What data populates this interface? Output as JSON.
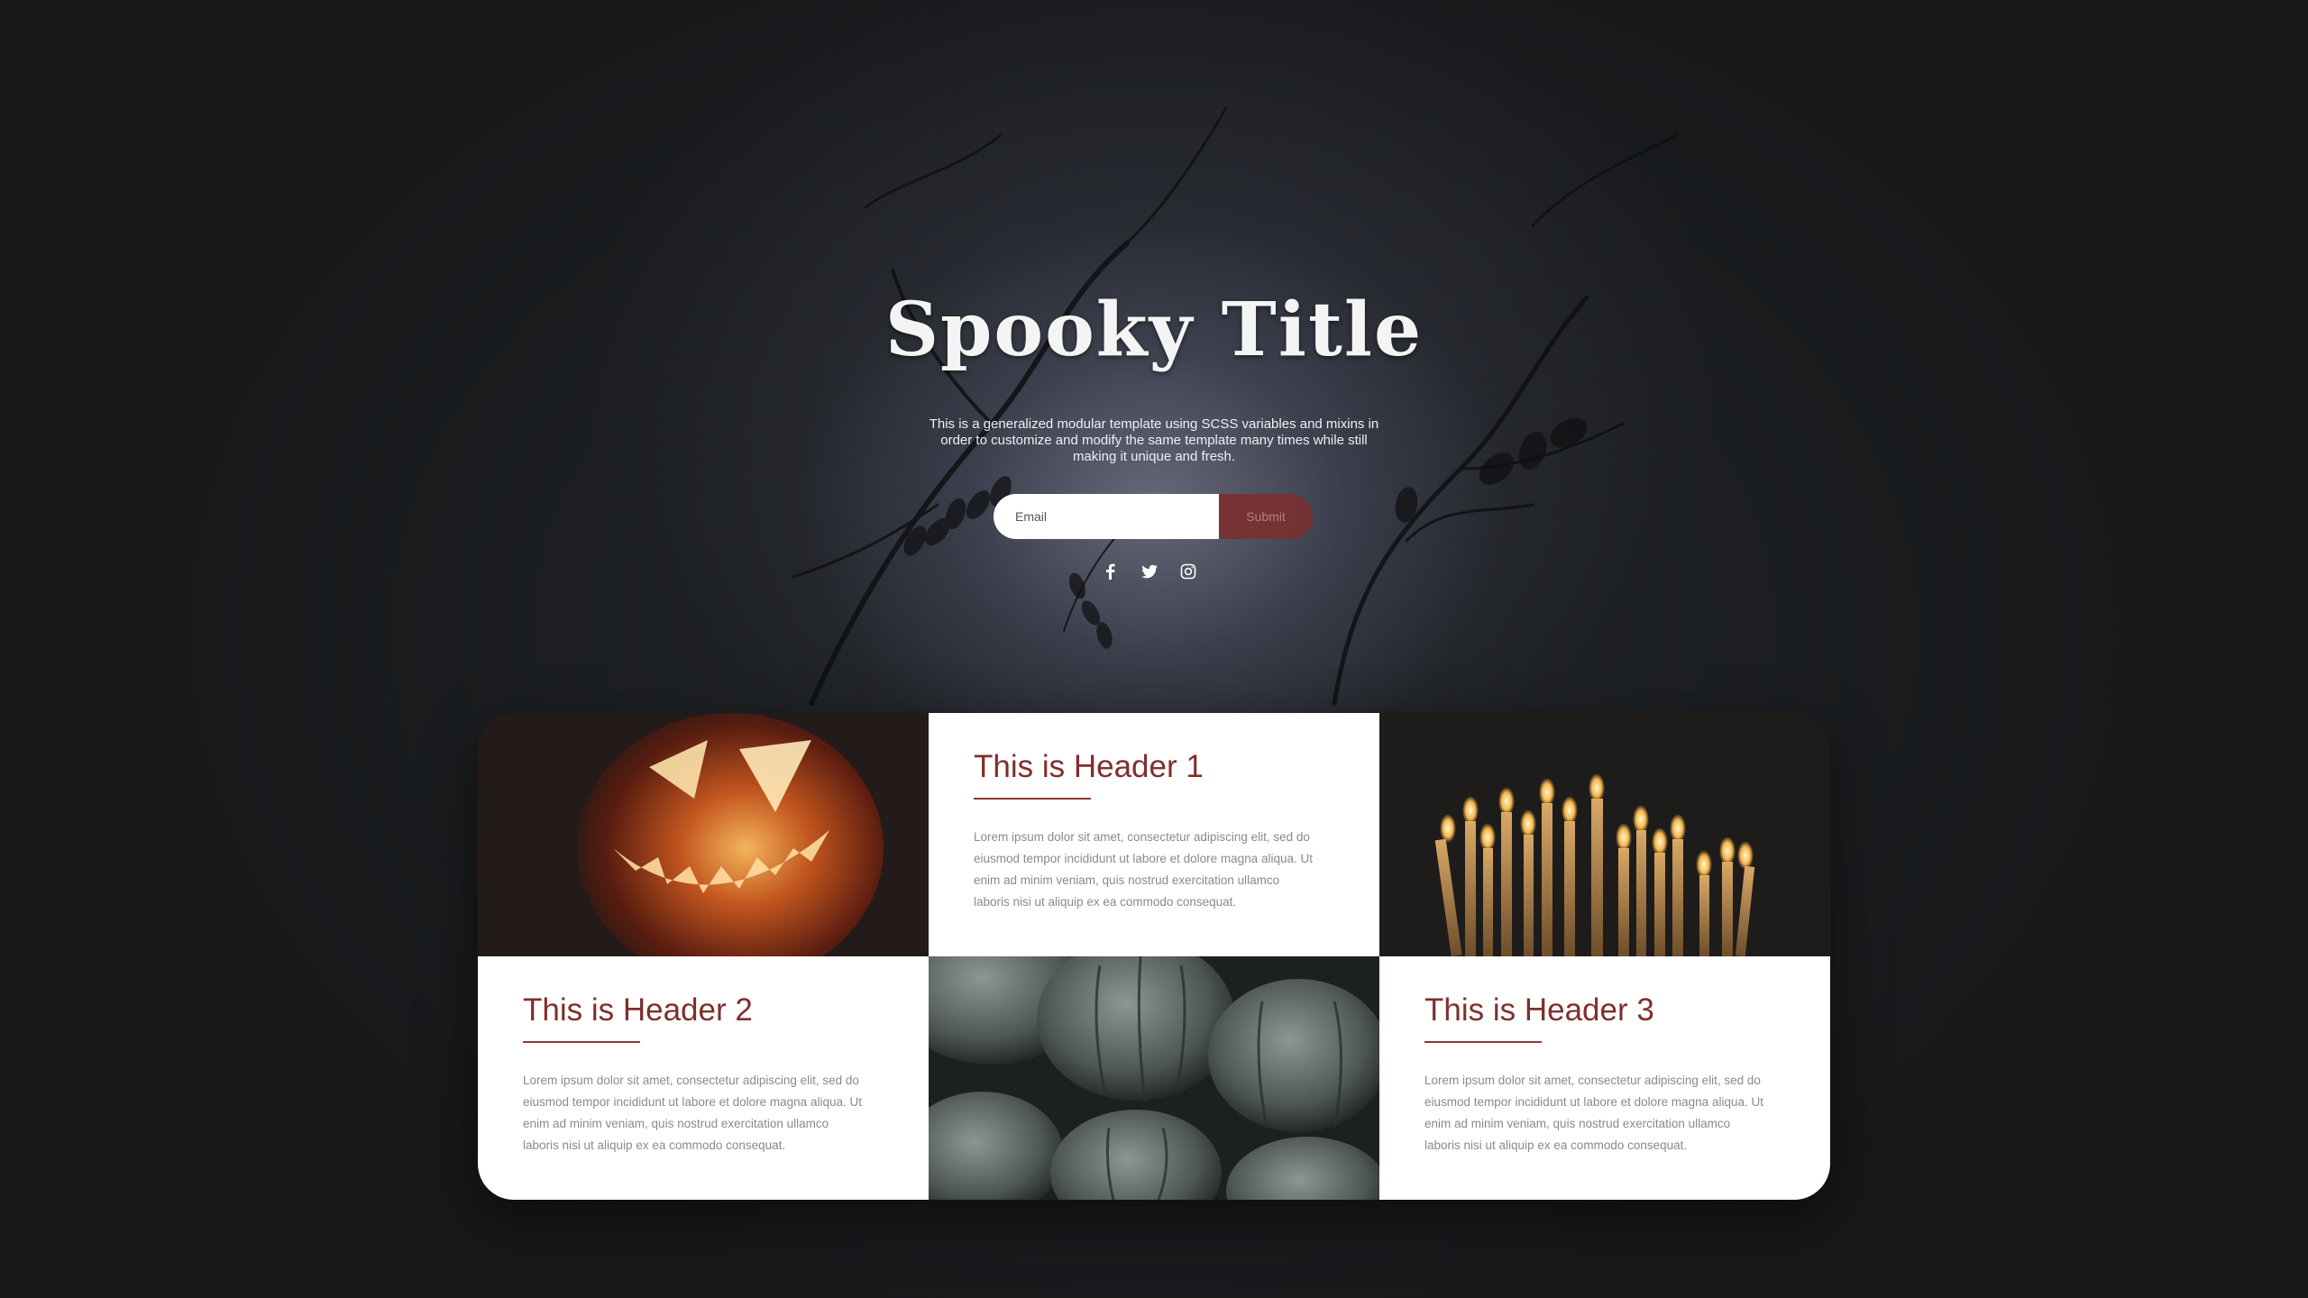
{
  "hero": {
    "title": "Spooky Title",
    "subtitle": "This is a generalized modular template using SCSS variables and mixins in order to customize and modify the same template many times while still making it unique and fresh.",
    "email_placeholder": "Email",
    "submit_label": "Submit",
    "social": [
      "facebook-icon",
      "twitter-icon",
      "instagram-icon"
    ]
  },
  "cards": [
    {
      "title": "This is Header 1",
      "body": "Lorem ipsum dolor sit amet, consectetur adipiscing elit, sed do eiusmod tempor incididunt ut labore et dolore magna aliqua. Ut enim ad minim veniam, quis nostrud exercitation ullamco laboris nisi ut aliquip ex ea commodo consequat."
    },
    {
      "title": "This is Header 2",
      "body": "Lorem ipsum dolor sit amet, consectetur adipiscing elit, sed do eiusmod tempor incididunt ut labore et dolore magna aliqua. Ut enim ad minim veniam, quis nostrud exercitation ullamco laboris nisi ut aliquip ex ea commodo consequat."
    },
    {
      "title": "This is Header 3",
      "body": "Lorem ipsum dolor sit amet, consectetur adipiscing elit, sed do eiusmod tempor incididunt ut labore et dolore magna aliqua. Ut enim ad minim veniam, quis nostrud exercitation ullamco laboris nisi ut aliquip ex ea commodo consequat."
    }
  ],
  "images": {
    "top_left": "jack-o-lantern",
    "top_right": "candles",
    "bottom_middle": "pumpkins"
  },
  "colors": {
    "accent": "#7f2f2d",
    "background": "#1c1e20",
    "card_bg": "#ffffff",
    "body_text": "#8a8a8a"
  }
}
